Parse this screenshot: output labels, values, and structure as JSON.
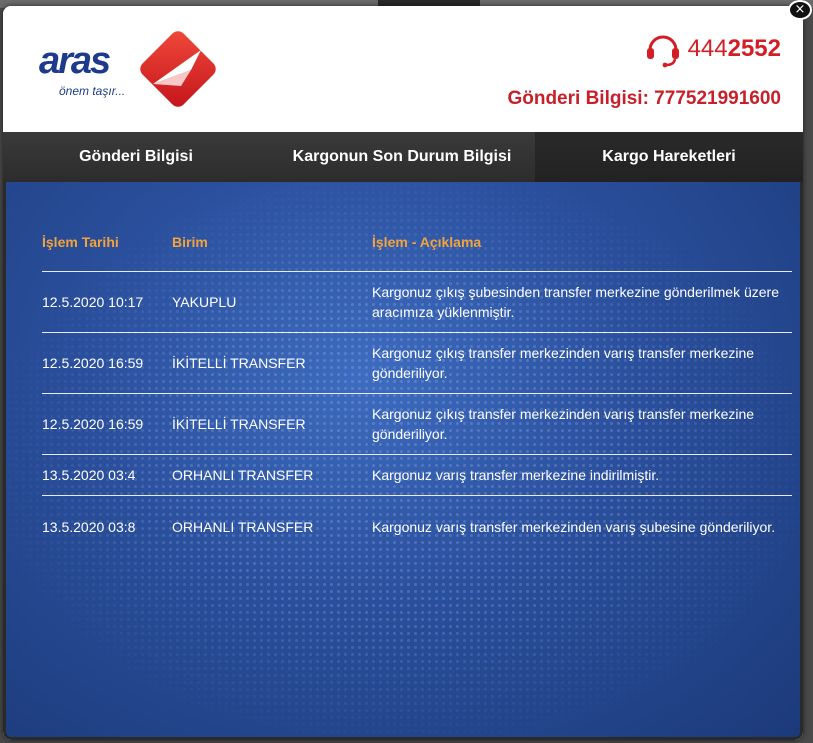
{
  "brand": {
    "name": "aras",
    "slogan": "önem taşır...",
    "primary_color": "#d21e24",
    "logo_color": "#1d3a8c"
  },
  "phone": {
    "prefix": "444",
    "suffix": "2552",
    "icon": "headset-icon"
  },
  "shipment": {
    "title": "Gönderi Bilgisi: 777521991600"
  },
  "tabs": [
    {
      "label": "Gönderi Bilgisi",
      "active": false
    },
    {
      "label": "Kargonun Son Durum Bilgisi",
      "active": false
    },
    {
      "label": "Kargo Hareketleri",
      "active": true
    }
  ],
  "table": {
    "headers": [
      "İşlem Tarihi",
      "Birim",
      "İşlem - Açıklama"
    ],
    "header_color": "#f2a33a",
    "rows": [
      {
        "date": "12.5.2020 10:17",
        "unit": "YAKUPLU",
        "desc": "Kargonuz çıkış şubesinden transfer merkezine gönderilmek üzere aracımıza yüklenmiştir."
      },
      {
        "date": "12.5.2020 16:59",
        "unit": "İKİTELLİ TRANSFER",
        "desc": "Kargonuz çıkış transfer merkezinden varış transfer merkezine gönderiliyor."
      },
      {
        "date": "12.5.2020 16:59",
        "unit": "İKİTELLİ TRANSFER",
        "desc": "Kargonuz çıkış transfer merkezinden varış transfer merkezine gönderiliyor."
      },
      {
        "date": "13.5.2020 03:4",
        "unit": "ORHANLI TRANSFER",
        "desc": "Kargonuz varış transfer merkezine indirilmiştir."
      },
      {
        "date": "13.5.2020 03:8",
        "unit": "ORHANLI TRANSFER",
        "desc": "Kargonuz varış transfer merkezinden varış şubesine gönderiliyor."
      }
    ]
  },
  "close": {
    "label": "×"
  }
}
